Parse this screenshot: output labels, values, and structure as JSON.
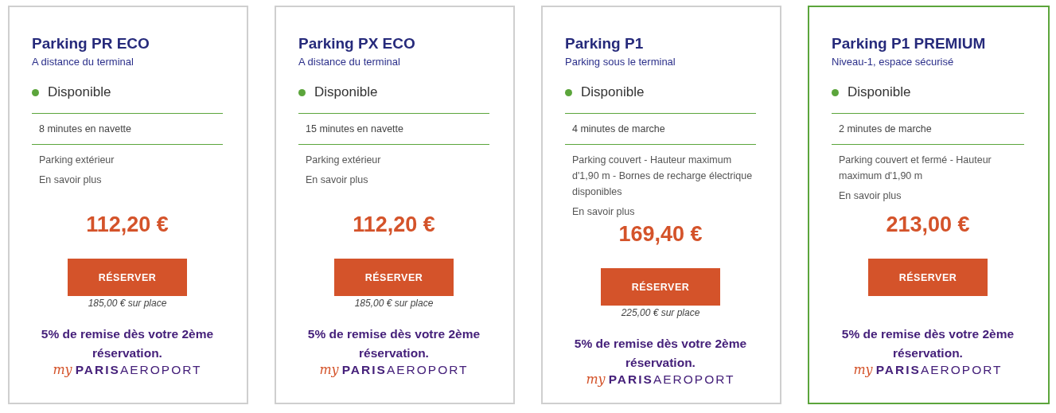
{
  "cards": [
    {
      "title": "Parking PR ECO",
      "subtitle": "A distance du terminal",
      "status": "Disponible",
      "access": "8 minutes en navette",
      "description": "Parking extérieur",
      "more_link": "En savoir plus",
      "price": "112,20 €",
      "button": "RÉSERVER",
      "onsite_price": "185,00 € sur place",
      "promo": "5% de remise dès votre 2ème réservation.",
      "logo": [
        "my",
        "PARIS",
        "AEROPORT"
      ],
      "selected": false
    },
    {
      "title": "Parking PX ECO",
      "subtitle": "A distance du terminal",
      "status": "Disponible",
      "access": "15 minutes en navette",
      "description": "Parking extérieur",
      "more_link": "En savoir plus",
      "price": "112,20 €",
      "button": "RÉSERVER",
      "onsite_price": "185,00 € sur place",
      "promo": "5% de remise dès votre 2ème réservation.",
      "logo": [
        "my",
        "PARIS",
        "AEROPORT"
      ],
      "selected": false
    },
    {
      "title": "Parking P1",
      "subtitle": "Parking sous le terminal",
      "status": "Disponible",
      "access": "4 minutes de marche",
      "description": "Parking couvert - Hauteur maximum d'1,90 m - Bornes de recharge électrique disponibles",
      "more_link": "En savoir plus",
      "price": "169,40 €",
      "button": "RÉSERVER",
      "onsite_price": "225,00 € sur place",
      "promo": "5% de remise dès votre 2ème réservation.",
      "logo": [
        "my",
        "PARIS",
        "AEROPORT"
      ],
      "selected": false
    },
    {
      "title": "Parking P1 PREMIUM",
      "subtitle": "Niveau-1, espace sécurisé",
      "status": "Disponible",
      "access": "2 minutes de marche",
      "description": "Parking couvert et fermé - Hauteur maximum d'1,90 m",
      "more_link": "En savoir plus",
      "price": "213,00 €",
      "button": "RÉSERVER",
      "promo": "5% de remise dès votre 2ème réservation.",
      "logo": [
        "my",
        "PARIS",
        "AEROPORT"
      ],
      "selected": true
    }
  ]
}
